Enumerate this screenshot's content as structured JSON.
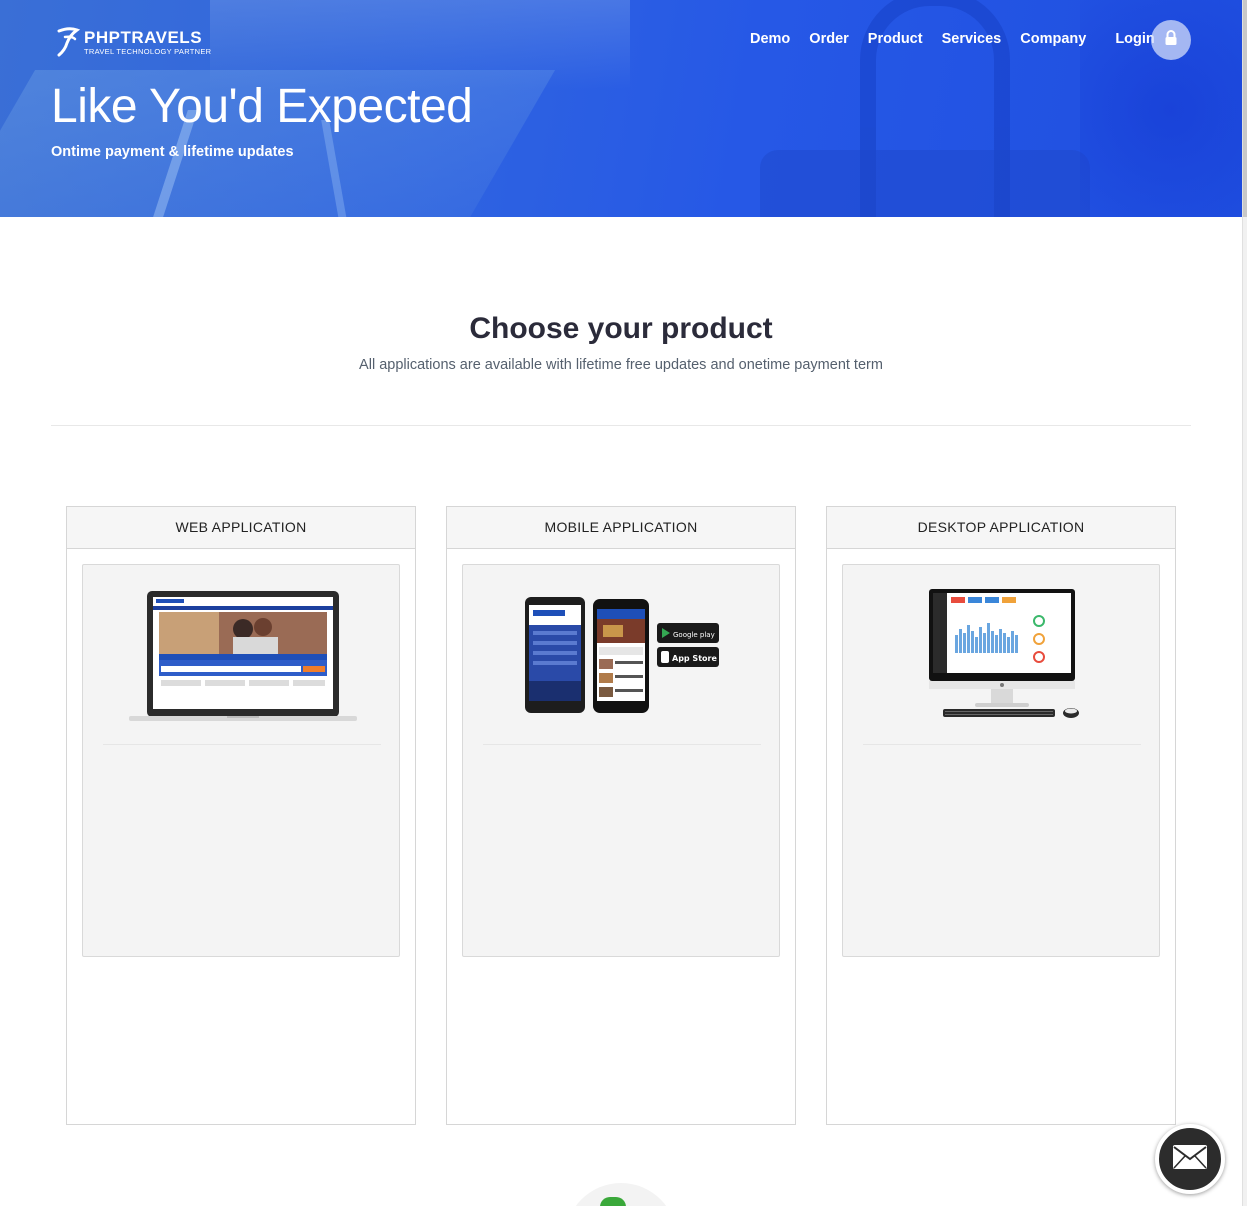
{
  "brand": {
    "name": "PHPTRAVELS",
    "tagline": "TRAVEL TECHNOLOGY PARTNER"
  },
  "nav": {
    "items": [
      "Demo",
      "Order",
      "Product",
      "Services",
      "Company"
    ],
    "login": "Login",
    "login_icon": "lock-icon"
  },
  "hero": {
    "title": "Like You'd Expected",
    "subtitle": "Ontime payment & lifetime updates"
  },
  "section": {
    "title": "Choose your product",
    "subtitle": "All applications are available with lifetime free updates and onetime payment term"
  },
  "products": [
    {
      "label": "WEB APPLICATION",
      "image": "laptop-illustration"
    },
    {
      "label": "MOBILE APPLICATION",
      "image": "phones-illustration"
    },
    {
      "label": "DESKTOP APPLICATION",
      "image": "desktop-illustration"
    }
  ],
  "mobile_badges": [
    "Google play",
    "App Store"
  ],
  "chat": {
    "icon": "mail-icon"
  },
  "colors": {
    "hero_blue": "#2658e6",
    "card_border": "#d6d6d6",
    "accent_orange": "#f07d2b"
  }
}
